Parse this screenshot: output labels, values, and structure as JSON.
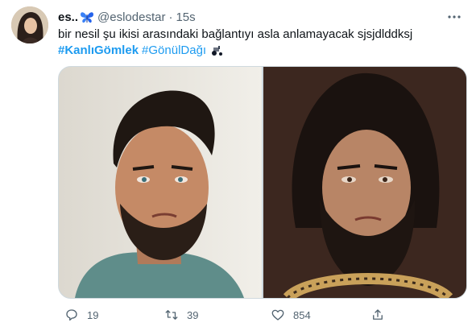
{
  "tweet": {
    "display_name": "es..",
    "handle": "@eslodestar",
    "separator": "·",
    "time": "15s",
    "text": "bir nesil şu ikisi arasındaki bağlantıyı asla anlamayacak sjsjdlddksj",
    "hashtags": [
      "#KanlıGömlek",
      "#GönülDağı"
    ],
    "name_emoji_icon": "butterfly-icon",
    "hashtag_emoji_icon": "tractor-icon"
  },
  "media": {
    "left_photo": "man-with-short-beard-photo",
    "right_photo": "man-with-long-beard-photo"
  },
  "actions": {
    "reply_count": "19",
    "retweet_count": "39",
    "like_count": "854"
  },
  "colors": {
    "accent": "#1d9bf0",
    "secondary_text": "#536471",
    "primary_text": "#0f1419"
  }
}
